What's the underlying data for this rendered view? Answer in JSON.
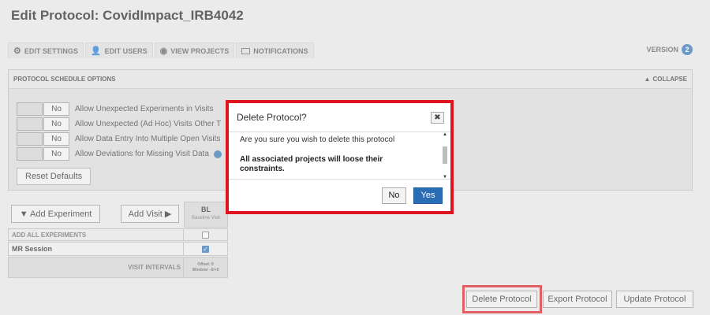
{
  "page": {
    "title": "Edit Protocol: CovidImpact_IRB4042"
  },
  "tabs": [
    {
      "label": "EDIT SETTINGS",
      "icon": "gear-icon"
    },
    {
      "label": "EDIT USERS",
      "icon": "user-icon"
    },
    {
      "label": "VIEW PROJECTS",
      "icon": "eye-icon"
    },
    {
      "label": "NOTIFICATIONS",
      "icon": "envelope-icon"
    }
  ],
  "version": {
    "label": "VERSION",
    "number": "2"
  },
  "schedule_panel": {
    "title": "PROTOCOL SCHEDULE OPTIONS",
    "collapse_label": "COLLAPSE",
    "options": [
      {
        "toggle": "No",
        "label": "Allow Unexpected Experiments in Visits"
      },
      {
        "toggle": "No",
        "label": "Allow Unexpected (Ad Hoc) Visits Other T"
      },
      {
        "toggle": "No",
        "label": "Allow Data Entry Into Multiple Open Visits"
      },
      {
        "toggle": "No",
        "label": "Allow Deviations for Missing Visit Data"
      }
    ],
    "reset_label": "Reset Defaults"
  },
  "schedule_grid": {
    "add_experiment_label": "▼ Add Experiment",
    "add_visit_label": "Add Visit ▶",
    "visit": {
      "code": "BL",
      "name": "Baseline Visit"
    },
    "rows": [
      {
        "label": "ADD ALL EXPERIMENTS",
        "checked": false
      },
      {
        "label": "MR Session",
        "checked": true
      }
    ],
    "intervals": {
      "label": "VISIT INTERVALS",
      "offset": "Offset: 0",
      "window": "Window: -0/+0"
    }
  },
  "footer_buttons": {
    "delete": "Delete Protocol",
    "export": "Export Protocol",
    "update": "Update Protocol"
  },
  "dialog": {
    "title": "Delete Protocol?",
    "close_glyph": "✖",
    "message": "Are you sure you wish to delete this protocol",
    "warning": "All associated projects will loose their constraints.",
    "no_label": "No",
    "yes_label": "Yes"
  },
  "colors": {
    "highlight": "#e0141e",
    "accent": "#2a6db5"
  }
}
